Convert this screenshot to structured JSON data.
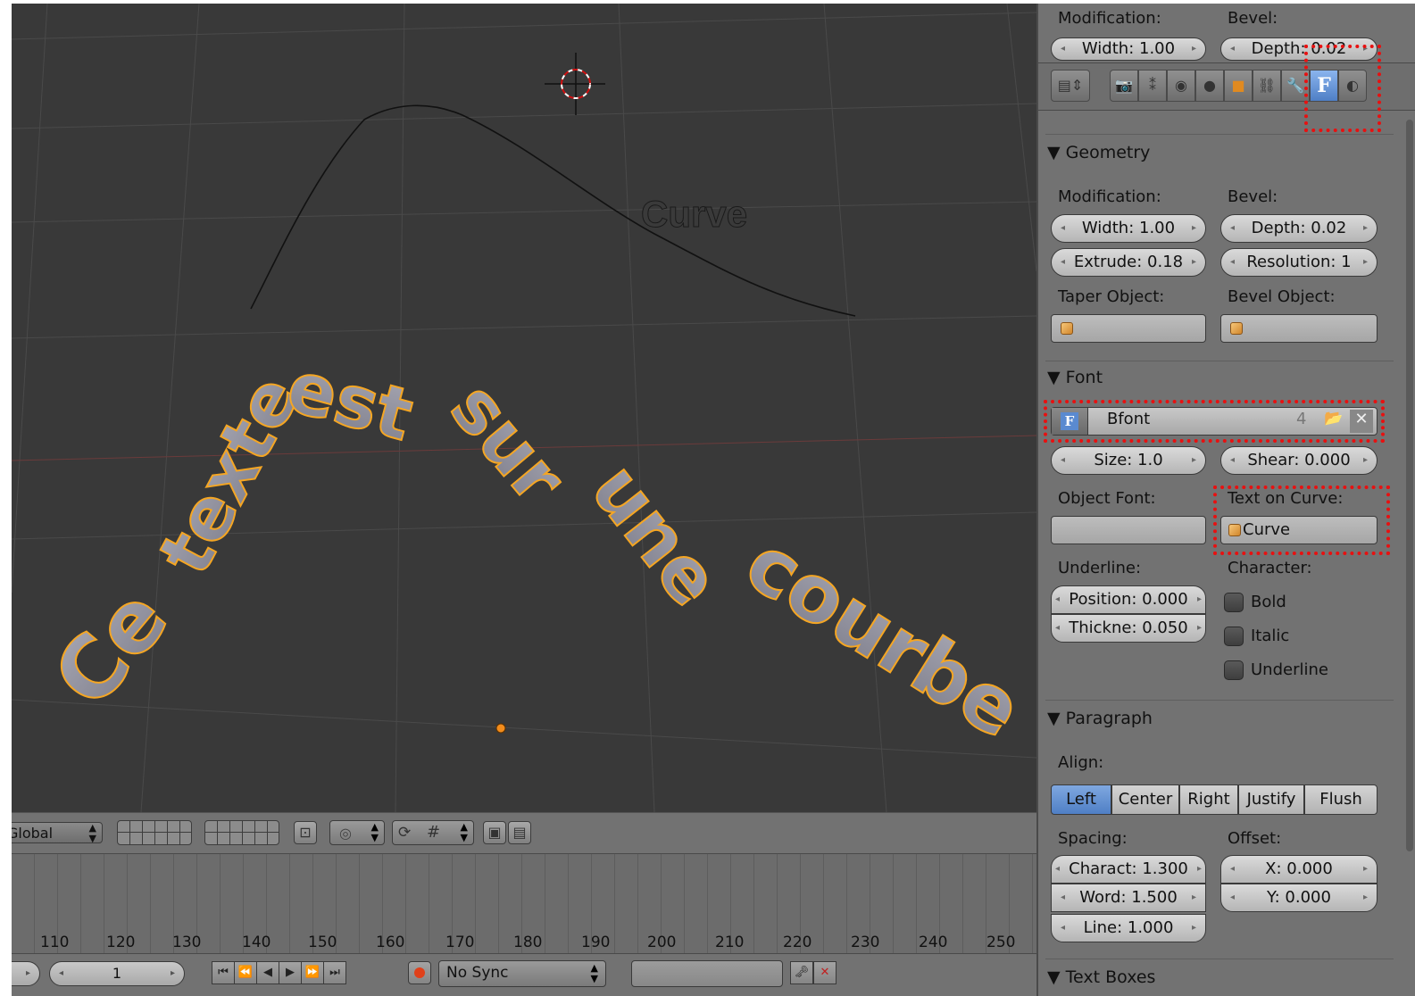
{
  "viewport": {
    "curve_label": "Curve",
    "text_on_curve": "Ce texte est sur une courbe"
  },
  "viewport_header": {
    "orientation": "Global"
  },
  "timeline": {
    "ruler": [
      "110",
      "120",
      "130",
      "140",
      "150",
      "160",
      "170",
      "180",
      "190",
      "200",
      "210",
      "220",
      "230",
      "240",
      "250"
    ],
    "current_frame": "1",
    "sync": "No Sync"
  },
  "props": {
    "top": {
      "modification": "Modification:",
      "bevel": "Bevel:",
      "width": "Width: 1.00",
      "depth": "Depth: 0.02"
    },
    "geometry": {
      "title": "Geometry",
      "modification": "Modification:",
      "bevel": "Bevel:",
      "width": "Width: 1.00",
      "depth": "Depth: 0.02",
      "extrude": "Extrude: 0.18",
      "resolution": "Resolution: 1",
      "taper_object": "Taper Object:",
      "bevel_object": "Bevel Object:"
    },
    "font": {
      "title": "Font",
      "font_name": "Bfont",
      "users": "4",
      "size": "Size: 1.0",
      "shear": "Shear: 0.000",
      "object_font": "Object Font:",
      "text_on_curve": "Text on Curve:",
      "curve_object": "Curve",
      "underline": "Underline:",
      "character": "Character:",
      "position": "Position: 0.000",
      "thickness": "Thickne: 0.050",
      "bold": "Bold",
      "italic": "Italic",
      "underline_check": "Underline"
    },
    "paragraph": {
      "title": "Paragraph",
      "align": "Align:",
      "align_options": [
        "Left",
        "Center",
        "Right",
        "Justify",
        "Flush"
      ],
      "spacing": "Spacing:",
      "offset": "Offset:",
      "character": "Charact: 1.300",
      "word": "Word: 1.500",
      "line": "Line: 1.000",
      "x": "X: 0.000",
      "y": "Y: 0.000"
    },
    "text_boxes": {
      "title": "Text Boxes"
    }
  },
  "colors": {
    "viewport_bg": "#393939",
    "panel_bg": "#727272",
    "selection_outline": "#f5a623",
    "highlight": "#e81010",
    "active_button": "#5a8ad0"
  }
}
